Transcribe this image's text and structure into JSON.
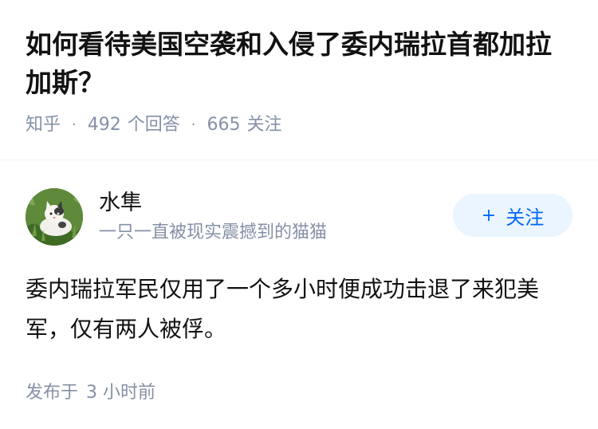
{
  "question": {
    "title": "如何看待美国空袭和入侵了委内瑞拉首都加拉加斯？",
    "source": "知乎",
    "answer_count": "492",
    "answer_label": "个回答",
    "follower_count": "665",
    "follower_label": "关注",
    "separator": "·"
  },
  "answer": {
    "author_name": "水隼",
    "author_bio": "一只一直被现实震撼到的猫猫",
    "follow_plus": "+",
    "follow_label": "关注",
    "content": "委内瑞拉军民仅用了一个多小时便成功击退了来犯美军，仅有两人被俘。",
    "time_prefix": "发布于",
    "time_value": "3 小时前"
  },
  "colors": {
    "title": "#121212",
    "meta": "#8590a6",
    "follow_bg": "#ebf5ff",
    "follow_text": "#0066ff"
  },
  "icons": {
    "avatar": "cat-photo-avatar"
  }
}
